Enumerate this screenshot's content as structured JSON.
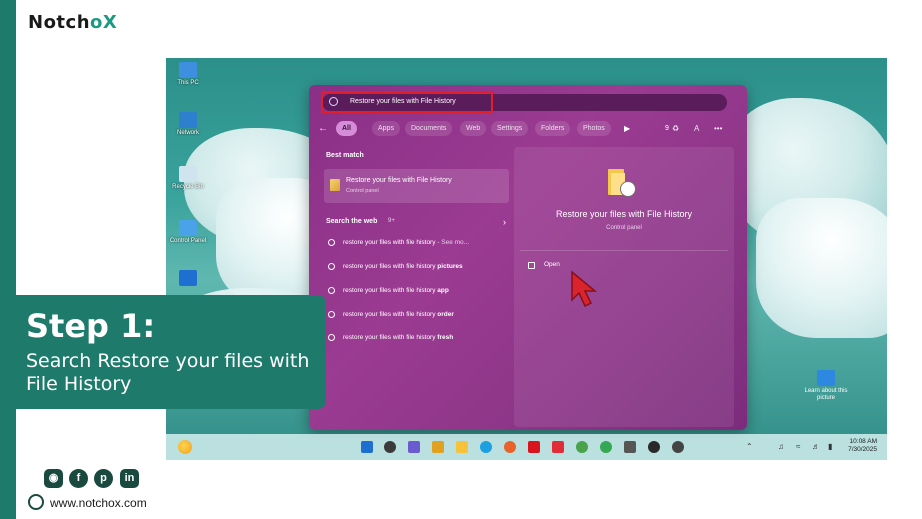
{
  "brand": {
    "prefix": "Notch",
    "o": "o",
    "x": "X"
  },
  "desktop": {
    "icons": [
      {
        "label": "This PC",
        "icon": "computer-icon"
      },
      {
        "label": "Network",
        "icon": "network-icon"
      },
      {
        "label": "Recycle Bin",
        "icon": "recycle-bin-icon"
      },
      {
        "label": "Control Panel",
        "icon": "control-panel-icon"
      }
    ],
    "learn_label": "Learn about this picture"
  },
  "search": {
    "query": "Restore your files with File History",
    "tabs": [
      "All",
      "Apps",
      "Documents",
      "Web",
      "Settings",
      "Folders",
      "Photos"
    ],
    "active_tab": "All",
    "count": "9",
    "profile_initial": "A",
    "more": "•••"
  },
  "results": {
    "best_match_title": "Best match",
    "best_match": {
      "title": "Restore your files with File History",
      "subtitle": "Control panel"
    },
    "web_title": "Search the web",
    "web_count": "9+",
    "web_items": [
      {
        "text": "restore your files with file history",
        "suffix": " - See mo..."
      },
      {
        "text": "restore your files with file history ",
        "suffix": "pictures"
      },
      {
        "text": "restore your files with file history ",
        "suffix": "app"
      },
      {
        "text": "restore your files with file history ",
        "suffix": "order"
      },
      {
        "text": "restore your files with file history ",
        "suffix": "fresh"
      }
    ]
  },
  "preview": {
    "title": "Restore your files with File History",
    "subtitle": "Control panel",
    "open_label": "Open"
  },
  "taskbar": {
    "time": "10:08 AM",
    "date": "7/30/2025"
  },
  "step": {
    "title": "Step 1:",
    "description": "Search Restore your files with File History"
  },
  "footer": {
    "socials": [
      "instagram-icon",
      "facebook-icon",
      "pinterest-icon",
      "linkedin-icon"
    ],
    "website": "www.notchox.com"
  },
  "colors": {
    "accent": "#1e7b6b",
    "panel": "#8a2f86",
    "highlight": "#e01f2a"
  }
}
